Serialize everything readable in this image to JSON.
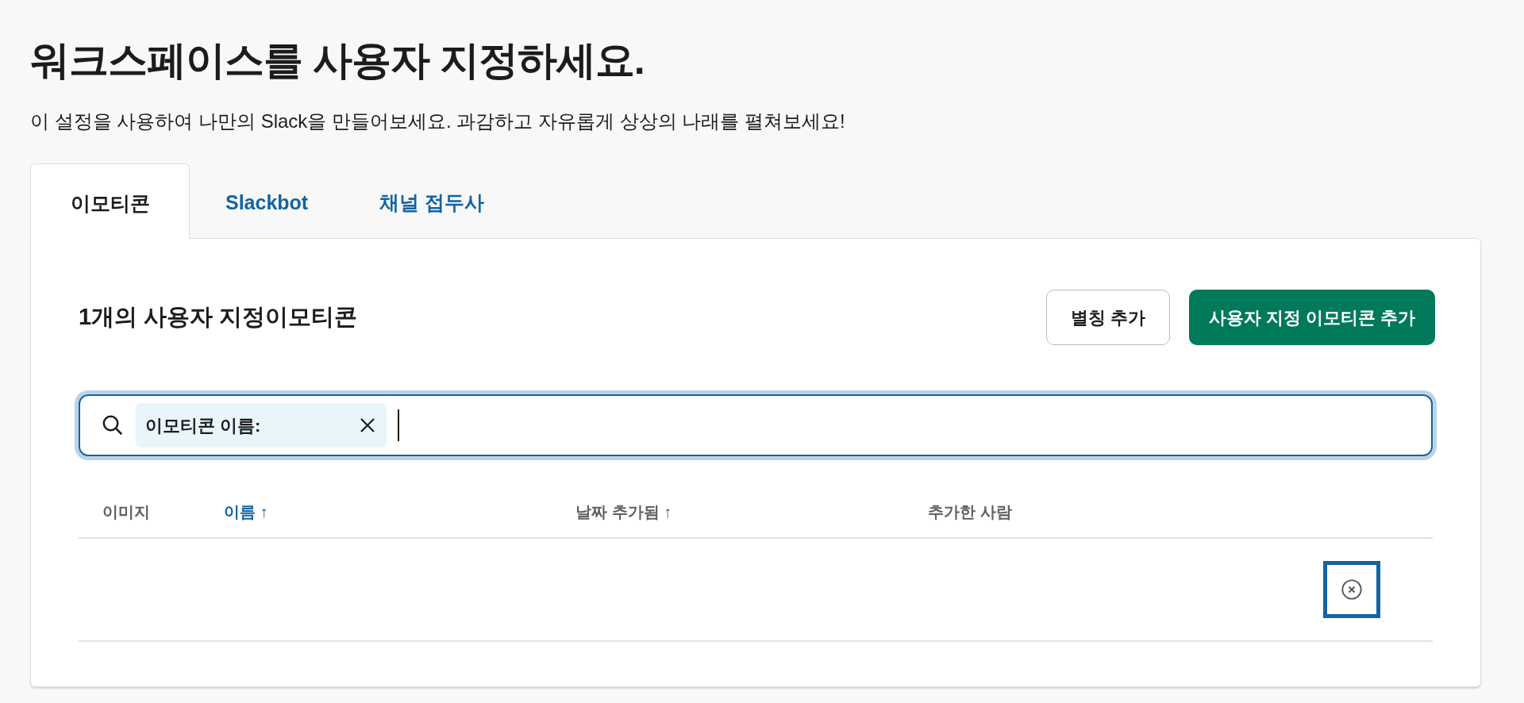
{
  "page": {
    "title": "워크스페이스를 사용자 지정하세요.",
    "subtitle": "이 설정을 사용하여 나만의 Slack을 만들어보세요. 과감하고 자유롭게 상상의 나래를 펼쳐보세요!"
  },
  "tabs": [
    {
      "label": "이모티콘",
      "selected": true
    },
    {
      "label": "Slackbot",
      "selected": false
    },
    {
      "label": "채널 접두사",
      "selected": false
    }
  ],
  "panel": {
    "heading": "1개의 사용자 지정이모티콘",
    "buttons": [
      {
        "label": "별칭 추가",
        "kind": "secondary"
      },
      {
        "label": "사용자 지정 이모티콘 추가",
        "kind": "primary"
      }
    ],
    "search": {
      "filter_chip": "이모티콘 이름:",
      "focused": true
    },
    "table": {
      "columns": [
        {
          "label": "이미지",
          "active": false
        },
        {
          "label": "이름",
          "sort_arrow": "↑",
          "active": true
        },
        {
          "label": "날짜 추가됨",
          "sort_arrow": "↑",
          "active": false
        },
        {
          "label": "추가한 사람",
          "active": false
        }
      ],
      "rows": [
        {
          "delete_focused": true
        }
      ]
    }
  }
}
